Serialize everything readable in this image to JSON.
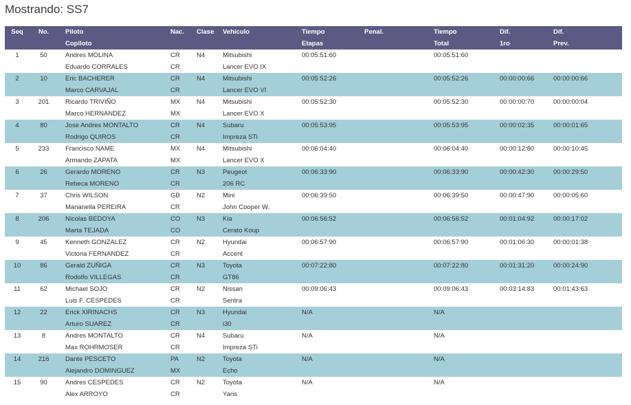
{
  "title": "Mostrando: SS7",
  "headers": {
    "seq": "Seq",
    "no": "No.",
    "piloto": "Piloto",
    "copiloto": "Copiloto",
    "nac": "Nac.",
    "clase": "Clase",
    "vehiculo": "Vehículo",
    "tiempo": "Tiempo",
    "etapas": "Etapas",
    "penal": "Penal.",
    "tiempo_total_1": "Tiempo",
    "tiempo_total_2": "Total",
    "dif1ro_1": "Dif.",
    "dif1ro_2": "1ro",
    "difprev_1": "Dif.",
    "difprev_2": "Prev."
  },
  "rows": [
    {
      "seq": "1",
      "no": "50",
      "piloto": "Andres MOLINA",
      "copiloto": "Eduardo CORRALES",
      "nac1": "CR",
      "nac2": "CR",
      "clase": "N4",
      "veh1": "Mitsubishi",
      "veh2": "Lancer EVO IX",
      "tiempo": "00:05:51:60",
      "penal": "",
      "total": "00:05:51:60",
      "dif1": "",
      "difp": ""
    },
    {
      "seq": "2",
      "no": "10",
      "piloto": "Eric BACHERER",
      "copiloto": "Marco CARVAJAL",
      "nac1": "CR",
      "nac2": "CR",
      "clase": "N4",
      "veh1": "Mitsubishi",
      "veh2": "Lancer EVO VI",
      "tiempo": "00:05:52:26",
      "penal": "",
      "total": "00:05:52:26",
      "dif1": "00:00:00:66",
      "difp": "00:00:00:66"
    },
    {
      "seq": "3",
      "no": "201",
      "piloto": "Ricardo TRIVIÑO",
      "copiloto": "Marco HERNANDEZ",
      "nac1": "MX",
      "nac2": "MX",
      "clase": "N4",
      "veh1": "Mitsubishi",
      "veh2": "Lancer EVO X",
      "tiempo": "00:05:52:30",
      "penal": "",
      "total": "00:05:52:30",
      "dif1": "00:00:00:70",
      "difp": "00:00:00:04"
    },
    {
      "seq": "4",
      "no": "80",
      "piloto": "Jose Andres MONTALTO",
      "copiloto": "Rodrigo QUIROS",
      "nac1": "CR",
      "nac2": "CR",
      "clase": "N4",
      "veh1": "Subaru",
      "veh2": "Impreza STi",
      "tiempo": "00:05:53:95",
      "penal": "",
      "total": "00:05:53:95",
      "dif1": "00:00:02:35",
      "difp": "00:00:01:65"
    },
    {
      "seq": "5",
      "no": "233",
      "piloto": "Francisco NAME",
      "copiloto": "Armando ZAPATA",
      "nac1": "MX",
      "nac2": "MX",
      "clase": "N4",
      "veh1": "Mitsubishi",
      "veh2": "Lancer EVO X",
      "tiempo": "00:06:04:40",
      "penal": "",
      "total": "00:06:04:40",
      "dif1": "00:00:12:80",
      "difp": "00:00:10:45"
    },
    {
      "seq": "6",
      "no": "26",
      "piloto": "Gerardo MORENO",
      "copiloto": "Rebeca MORENO",
      "nac1": "CR",
      "nac2": "CR",
      "clase": "N3",
      "veh1": "Peugeot",
      "veh2": "206 RC",
      "tiempo": "00:06:33:90",
      "penal": "",
      "total": "00:06:33:90",
      "dif1": "00:00:42:30",
      "difp": "00:00:29:50"
    },
    {
      "seq": "7",
      "no": "37",
      "piloto": "Chris WILSON",
      "copiloto": "Marianella PEREIRA",
      "nac1": "GB",
      "nac2": "CR",
      "clase": "N2",
      "veh1": "Mini",
      "veh2": "John Cooper W.",
      "tiempo": "00:06:39:50",
      "penal": "",
      "total": "00:06:39:50",
      "dif1": "00:00:47:90",
      "difp": "00:00:05:60"
    },
    {
      "seq": "8",
      "no": "206",
      "piloto": "Nicolas BEDOYA",
      "copiloto": "Marta TEJADA",
      "nac1": "CO",
      "nac2": "CO",
      "clase": "N3",
      "veh1": "Kia",
      "veh2": "Cerato Koup",
      "tiempo": "00:06:56:52",
      "penal": "",
      "total": "00:06:56:52",
      "dif1": "00:01:04:92",
      "difp": "00:00:17:02"
    },
    {
      "seq": "9",
      "no": "45",
      "piloto": "Kenneth GONZALEZ",
      "copiloto": "Victoria FERNANDEZ",
      "nac1": "CR",
      "nac2": "CR",
      "clase": "N2",
      "veh1": "Hyundai",
      "veh2": "Accent",
      "tiempo": "00:06:57:90",
      "penal": "",
      "total": "00:06:57:90",
      "dif1": "00:01:06:30",
      "difp": "00:00:01:38"
    },
    {
      "seq": "10",
      "no": "86",
      "piloto": "Gerald ZUÑIGA",
      "copiloto": "Rodolfo VILLEGAS",
      "nac1": "CR",
      "nac2": "CR",
      "clase": "N3",
      "veh1": "Toyota",
      "veh2": "GT86",
      "tiempo": "00:07:22:80",
      "penal": "",
      "total": "00:07:22:80",
      "dif1": "00:01:31:20",
      "difp": "00:00:24:90"
    },
    {
      "seq": "11",
      "no": "62",
      "piloto": "Michael SOJO",
      "copiloto": "Luis F. CESPEDES",
      "nac1": "CR",
      "nac2": "CR",
      "clase": "N2",
      "veh1": "Nissan",
      "veh2": "Sentra",
      "tiempo": "00:09:06:43",
      "penal": "",
      "total": "00:09:06:43",
      "dif1": "00:03:14:83",
      "difp": "00:01:43:63"
    },
    {
      "seq": "12",
      "no": "22",
      "piloto": "Erick XIRINACHS",
      "copiloto": "Arturo SUAREZ",
      "nac1": "CR",
      "nac2": "CR",
      "clase": "N3",
      "veh1": "Hyundai",
      "veh2": "i30",
      "tiempo": "N/A",
      "penal": "",
      "total": "N/A",
      "dif1": "",
      "difp": ""
    },
    {
      "seq": "13",
      "no": "8",
      "piloto": "Andres MONTALTO",
      "copiloto": "Max ROHRMOSER",
      "nac1": "CR",
      "nac2": "CR",
      "clase": "N4",
      "veh1": "Subaru",
      "veh2": "Impreza STi",
      "tiempo": "N/A",
      "penal": "",
      "total": "N/A",
      "dif1": "",
      "difp": ""
    },
    {
      "seq": "14",
      "no": "216",
      "piloto": "Dante PESCETO",
      "copiloto": "Alejandro DOMINGUEZ",
      "nac1": "PA",
      "nac2": "MX",
      "clase": "N2",
      "veh1": "Toyota",
      "veh2": "Echo",
      "tiempo": "N/A",
      "penal": "",
      "total": "N/A",
      "dif1": "",
      "difp": ""
    },
    {
      "seq": "15",
      "no": "90",
      "piloto": "Andres CESPEDES",
      "copiloto": "Alex ARROYO",
      "nac1": "CR",
      "nac2": "CR",
      "clase": "N2",
      "veh1": "Toyota",
      "veh2": "Yaris",
      "tiempo": "N/A",
      "penal": "",
      "total": "N/A",
      "dif1": "",
      "difp": ""
    }
  ]
}
